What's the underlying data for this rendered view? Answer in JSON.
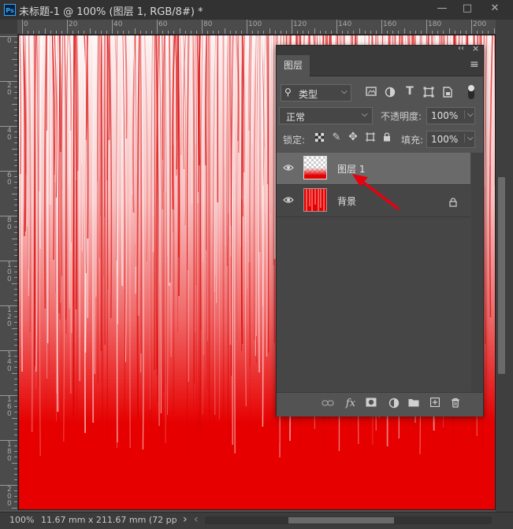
{
  "window": {
    "app_icon": "Ps",
    "title": "未标题-1 @ 100% (图层 1, RGB/8#) *",
    "minimize": "—",
    "maximize": "□",
    "close": "✕"
  },
  "rulers": {
    "top_labels": [
      "0",
      "20",
      "40",
      "60",
      "80",
      "100",
      "120",
      "140",
      "160",
      "180",
      "200"
    ],
    "left_labels": [
      "0",
      "2\n0",
      "4\n0",
      "6\n0",
      "8\n0",
      "1\n0\n0",
      "1\n2\n0",
      "1\n4\n0",
      "1\n6\n0",
      "1\n8\n0",
      "2\n0\n0"
    ]
  },
  "status": {
    "zoom": "100%",
    "doc_info": "11.67 mm x 211.67 mm (72 pp",
    "arrow_right": "›",
    "arrow_left": "‹"
  },
  "layers_panel": {
    "collapse": "‹‹",
    "close": "×",
    "tab_label": "图层",
    "menu_icon": "≡",
    "filter_kind": "类型",
    "blend_mode": "正常",
    "opacity_label": "不透明度:",
    "opacity_value": "100%",
    "lock_label": "锁定:",
    "fill_label": "填充:",
    "fill_value": "100%",
    "layers": [
      {
        "name": "图层 1",
        "selected": true,
        "locked": false
      },
      {
        "name": "背景",
        "selected": false,
        "locked": true
      }
    ],
    "lock_glyph": "🔒",
    "eye_glyph": "👁"
  },
  "colors": {
    "canvas_red": "#e60000",
    "annotation_arrow": "#e8000f",
    "panel_bg": "#535353",
    "selected_row": "#6a6a6a"
  }
}
